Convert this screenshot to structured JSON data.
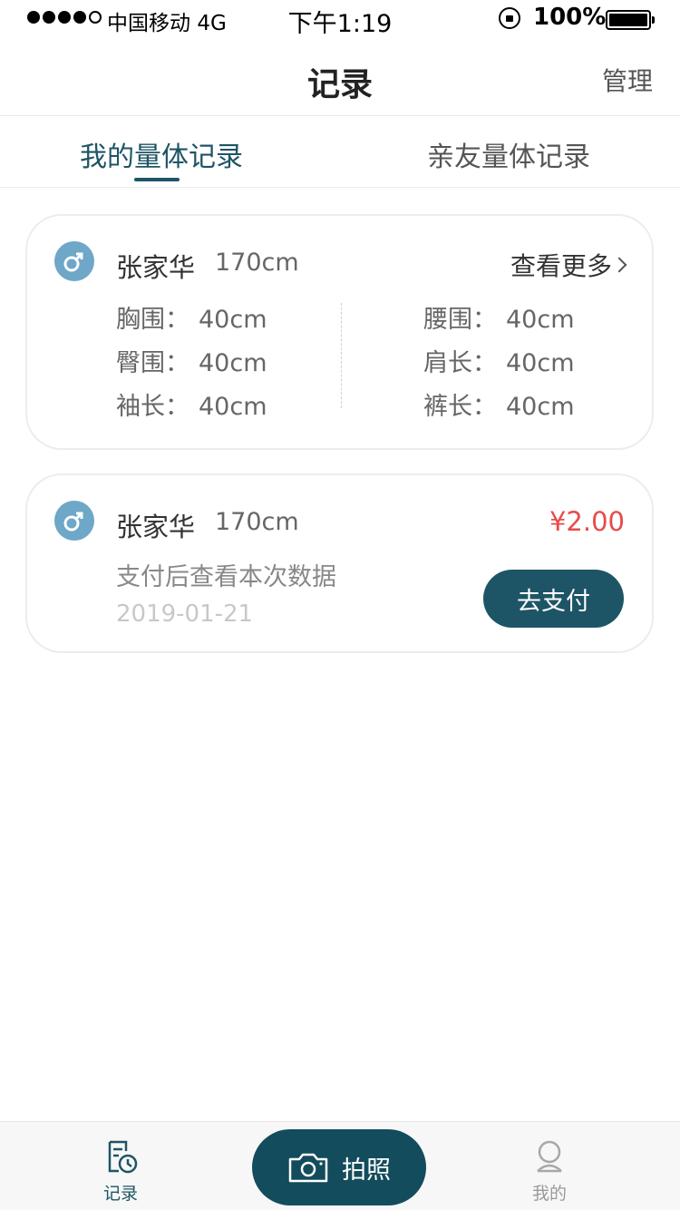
{
  "status_bar": {
    "carrier": "中国移动",
    "network": "4G",
    "time": "下午1:19",
    "battery": "100%"
  },
  "nav": {
    "title": "记录",
    "manage": "管理"
  },
  "tabs": [
    {
      "label": "我的量体记录",
      "active": true
    },
    {
      "label": "亲友量体记录",
      "active": false
    }
  ],
  "records": [
    {
      "gender_icon": "male-icon",
      "name": "张家华",
      "height": "170cm",
      "more": "查看更多",
      "measurements": [
        {
          "label": "胸围",
          "value": "40cm"
        },
        {
          "label": "腰围",
          "value": "40cm"
        },
        {
          "label": "臀围",
          "value": "40cm"
        },
        {
          "label": "肩长",
          "value": "40cm"
        },
        {
          "label": "袖长",
          "value": "40cm"
        },
        {
          "label": "裤长",
          "value": "40cm"
        }
      ]
    },
    {
      "gender_icon": "male-icon",
      "name": "张家华",
      "height": "170cm",
      "price": "¥2.00",
      "hint": "支付后查看本次数据",
      "date": "2019-01-21",
      "pay_button": "去支付"
    }
  ],
  "tabbar": {
    "record": "记录",
    "photo": "拍照",
    "mine": "我的"
  },
  "colors": {
    "accent": "#1e5565",
    "price": "#e84a4a",
    "gender_badge": "#6ea7c7"
  }
}
